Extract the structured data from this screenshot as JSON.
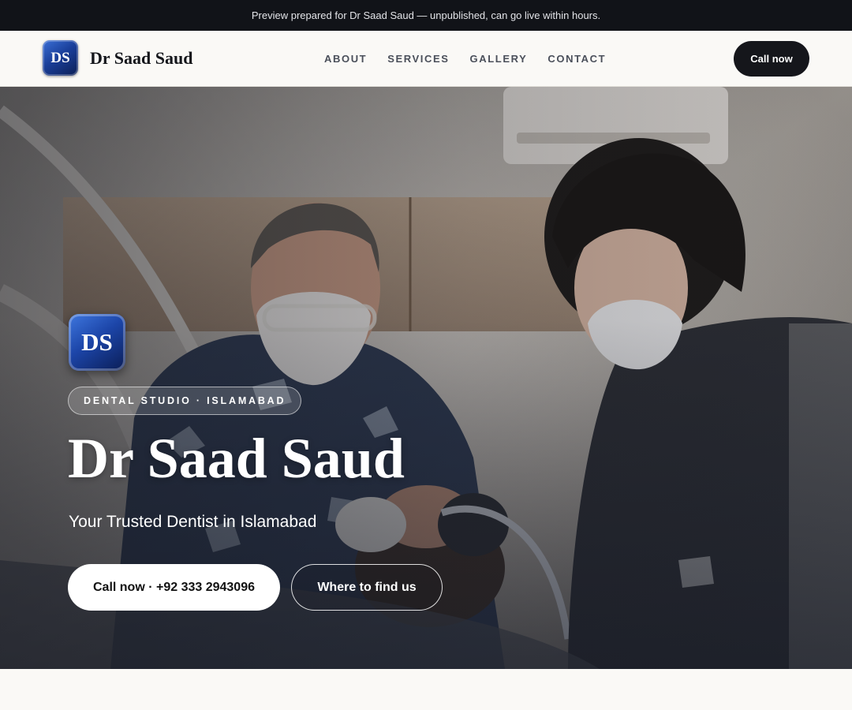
{
  "preview_banner": {
    "text": "Preview prepared for Dr Saad Saud — unpublished, can go live within hours."
  },
  "header": {
    "logo_text": "DS",
    "brand_name": "Dr Saad Saud",
    "nav": [
      {
        "label": "ABOUT"
      },
      {
        "label": "SERVICES"
      },
      {
        "label": "GALLERY"
      },
      {
        "label": "CONTACT"
      }
    ],
    "cta_label": "Call now"
  },
  "hero": {
    "logo_text": "DS",
    "badge": "DENTAL STUDIO · ISLAMABAD",
    "title": "Dr Saad Saud",
    "subtitle": "Your Trusted Dentist in Islamabad",
    "primary_button": "Call now · +92 333 2943096",
    "secondary_button": "Where to find us"
  },
  "colors": {
    "banner_bg": "#111318",
    "page_bg": "#faf9f6",
    "dark_button": "#15161b",
    "logo_blue": "#1c45a8"
  },
  "icons": {
    "hero_image": "dental-treatment-photo"
  }
}
